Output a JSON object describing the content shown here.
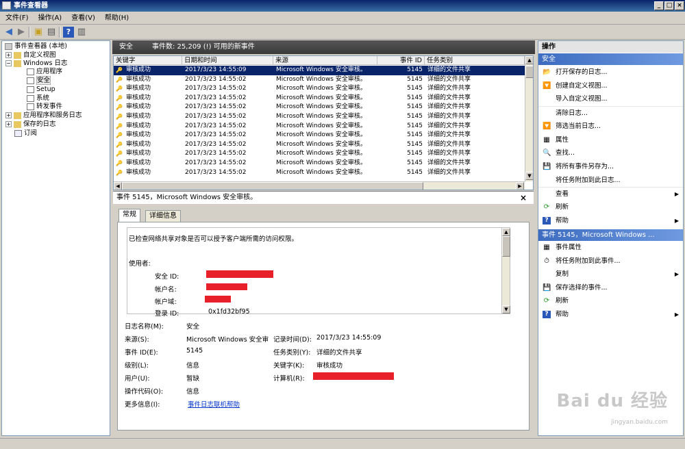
{
  "window": {
    "title": "事件查看器"
  },
  "menu": [
    "文件(F)",
    "操作(A)",
    "查看(V)",
    "帮助(H)"
  ],
  "tree": {
    "root": "事件查看器 (本地)",
    "custom_views": "自定义视图",
    "windows_logs": "Windows 日志",
    "children": [
      "应用程序",
      "安全",
      "Setup",
      "系统",
      "转发事件"
    ],
    "app_service_logs": "应用程序和服务日志",
    "saved_logs": "保存的日志",
    "subscriptions": "订阅"
  },
  "center": {
    "log_name": "安全",
    "event_count": "事件数: 25,209 (!) 可用的新事件",
    "columns": [
      "关键字",
      "日期和时间",
      "来源",
      "事件 ID",
      "任务类别"
    ],
    "rows": [
      [
        "审核成功",
        "2017/3/23 14:55:09",
        "Microsoft Windows 安全审核。",
        "5145",
        "详细的文件共享"
      ],
      [
        "审核成功",
        "2017/3/23 14:55:02",
        "Microsoft Windows 安全审核。",
        "5145",
        "详细的文件共享"
      ],
      [
        "审核成功",
        "2017/3/23 14:55:02",
        "Microsoft Windows 安全审核。",
        "5145",
        "详细的文件共享"
      ],
      [
        "审核成功",
        "2017/3/23 14:55:02",
        "Microsoft Windows 安全审核。",
        "5145",
        "详细的文件共享"
      ],
      [
        "审核成功",
        "2017/3/23 14:55:02",
        "Microsoft Windows 安全审核。",
        "5145",
        "详细的文件共享"
      ],
      [
        "审核成功",
        "2017/3/23 14:55:02",
        "Microsoft Windows 安全审核。",
        "5145",
        "详细的文件共享"
      ],
      [
        "审核成功",
        "2017/3/23 14:55:02",
        "Microsoft Windows 安全审核。",
        "5145",
        "详细的文件共享"
      ],
      [
        "审核成功",
        "2017/3/23 14:55:02",
        "Microsoft Windows 安全审核。",
        "5145",
        "详细的文件共享"
      ],
      [
        "审核成功",
        "2017/3/23 14:55:02",
        "Microsoft Windows 安全审核。",
        "5145",
        "详细的文件共享"
      ],
      [
        "审核成功",
        "2017/3/23 14:55:02",
        "Microsoft Windows 安全审核。",
        "5145",
        "详细的文件共享"
      ],
      [
        "审核成功",
        "2017/3/23 14:55:02",
        "Microsoft Windows 安全审核。",
        "5145",
        "详细的文件共享"
      ],
      [
        "审核成功",
        "2017/3/23 14:55:02",
        "Microsoft Windows 安全审核。",
        "5145",
        "详细的文件共享"
      ]
    ]
  },
  "details": {
    "header": "事件 5145，Microsoft Windows 安全审核。",
    "tabs": [
      "常规",
      "详细信息"
    ],
    "message": "已检查网络共享对象是否可以授予客户端所需的访问权限。",
    "subject_label": "使用者:",
    "security_id_label": "安全 ID:",
    "account_name_label": "帐户名:",
    "account_domain_label": "帐户域:",
    "logon_id_label": "登录 ID:",
    "logon_id_value": "0x1fd32bf95",
    "fields": {
      "log_name_label": "日志名称(M):",
      "log_name_value": "安全",
      "source_label": "来源(S):",
      "source_value": "Microsoft Windows 安全审",
      "logged_label": "记录时间(D):",
      "logged_value": "2017/3/23 14:55:09",
      "event_id_label": "事件 ID(E):",
      "event_id_value": "5145",
      "task_label": "任务类别(Y):",
      "task_value": "详细的文件共享",
      "level_label": "级别(L):",
      "level_value": "信息",
      "keywords_label": "关键字(K):",
      "keywords_value": "审核成功",
      "user_label": "用户(U):",
      "user_value": "暂缺",
      "computer_label": "计算机(R):",
      "opcode_label": "操作代码(O):",
      "opcode_value": "信息",
      "more_info_label": "更多信息(I):",
      "more_info_link": "事件日志联机帮助"
    }
  },
  "actions": {
    "title": "操作",
    "section1": "安全",
    "items1": [
      "打开保存的日志...",
      "创建自定义视图...",
      "导入自定义视图...",
      "清除日志...",
      "筛选当前日志...",
      "属性",
      "查找...",
      "将所有事件另存为...",
      "将任务附加到此日志...",
      "查看",
      "刷新",
      "帮助"
    ],
    "section2": "事件 5145，Microsoft Windows ...",
    "items2": [
      "事件属性",
      "将任务附加到此事件...",
      "复制",
      "保存选择的事件...",
      "刷新",
      "帮助"
    ]
  },
  "watermark": {
    "brand": "Bai du 经验",
    "url": "jingyan.baidu.com"
  }
}
